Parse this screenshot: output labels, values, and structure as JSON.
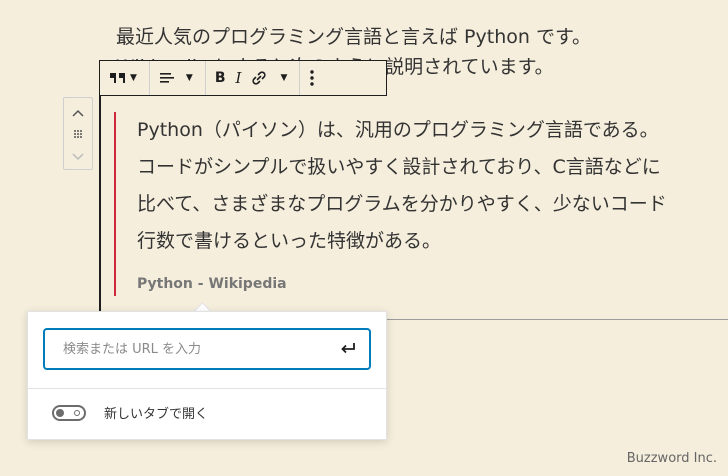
{
  "paragraph": {
    "line1": "最近人気のプログラミング言語と言えば Python です。",
    "line2": "Wikipedia によると次のように説明されています。"
  },
  "quote": {
    "lines": [
      "Python（パイソン）は、汎用のプログラミング言語である。",
      "コードがシンプルで扱いやすく設計されており、C言語などに",
      "比べて、さまざまなプログラムを分かりやすく、少ないコード",
      "行数で書けるといった特徴がある。"
    ],
    "citation": "Python - Wikipedia"
  },
  "toolbar": {
    "items": [
      "quote-block-icon",
      "align-icon",
      "bold-icon",
      "italic-icon",
      "link-icon",
      "more-options-icon"
    ],
    "bold_label": "B",
    "italic_label": "I"
  },
  "link_popover": {
    "placeholder": "検索または URL を入力",
    "toggle_label": "新しいタブで開く",
    "toggle_on": false
  },
  "watermark": "Buzzword Inc.",
  "colors": {
    "background": "#f5eedc",
    "accent": "#007cba",
    "quote_border": "#d0283b"
  }
}
